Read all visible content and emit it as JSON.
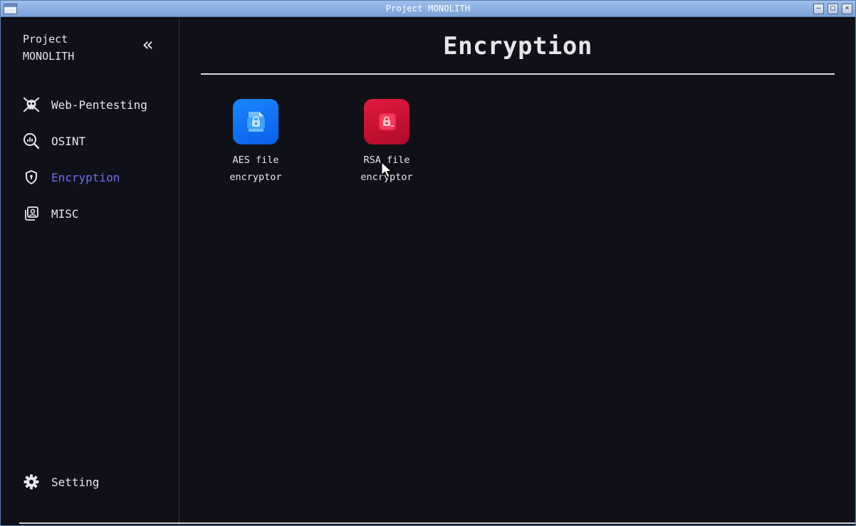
{
  "window": {
    "title": "Project MONOLITH",
    "controls": {
      "minimize": "–",
      "maximize": "□",
      "close": "×"
    }
  },
  "sidebar": {
    "brand": "Project MONOLITH",
    "collapse_glyph": "«",
    "items": [
      {
        "label": "Web-Pentesting",
        "icon": "skull-crossbones-icon",
        "active": false
      },
      {
        "label": "OSINT",
        "icon": "search-chart-icon",
        "active": false
      },
      {
        "label": "Encryption",
        "icon": "shield-icon",
        "active": true
      },
      {
        "label": "MISC",
        "icon": "photo-stack-icon",
        "active": false
      }
    ],
    "footer_item": {
      "label": "Setting",
      "icon": "gear-icon"
    }
  },
  "main": {
    "title": "Encryption",
    "tools": [
      {
        "label": "AES file encryptor",
        "icon": "blue-lock-file-icon",
        "color": "#1a86ff"
      },
      {
        "label": "RSA file encryptor",
        "icon": "red-lock-file-icon",
        "color": "#e01a3f"
      }
    ]
  },
  "colors": {
    "background": "#101118",
    "text": "#e6e6ea",
    "accent_active": "#6d6cf2",
    "titlebar": "#8fb2e4"
  }
}
